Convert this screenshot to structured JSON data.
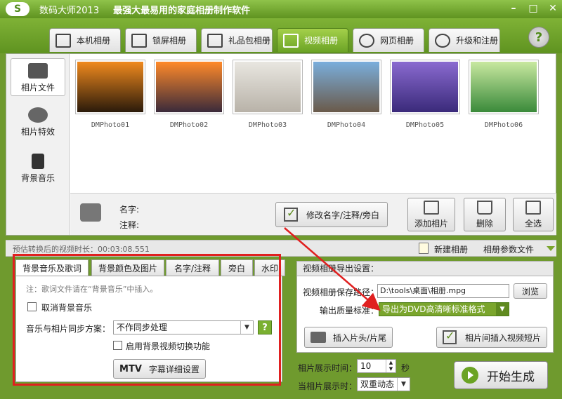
{
  "window": {
    "logo": "S",
    "title": "数码大师2013",
    "slogan": "最强大最易用的家庭相册制作软件",
    "minimize": "–",
    "maximize": "□",
    "close": "✕"
  },
  "tabs": [
    {
      "label": "本机相册"
    },
    {
      "label": "锁屏相册"
    },
    {
      "label": "礼品包相册"
    },
    {
      "label": "视频相册"
    },
    {
      "label": "网页相册"
    },
    {
      "label": "升级和注册"
    }
  ],
  "help": "?",
  "sidebar": {
    "items": [
      {
        "label": "相片文件"
      },
      {
        "label": "相片特效"
      },
      {
        "label": "背景音乐"
      }
    ]
  },
  "photos": [
    {
      "name": "DMPhoto01",
      "color_top": "#f08a1e",
      "color_bottom": "#2a1a0a"
    },
    {
      "name": "DMPhoto02",
      "color_top": "#ff8a2a",
      "color_bottom": "#3a2a3a"
    },
    {
      "name": "DMPhoto03",
      "color_top": "#e8e6e0",
      "color_bottom": "#b8b2a8"
    },
    {
      "name": "DMPhoto04",
      "color_top": "#7aaedc",
      "color_bottom": "#6a5a4a"
    },
    {
      "name": "DMPhoto05",
      "color_top": "#8a6ad0",
      "color_bottom": "#3a2a7a"
    },
    {
      "name": "DMPhoto06",
      "color_top": "#c8e8a0",
      "color_bottom": "#3a8a3a"
    }
  ],
  "info": {
    "name_label": "名字:",
    "note_label": "注释:",
    "edit_button": "修改名字/注释/旁白",
    "add_photo": "添加相片",
    "delete": "删除",
    "select_all": "全选"
  },
  "duration_bar": {
    "text": "预估转换后的视频时长：00:03:08.551",
    "new_album": "新建相册",
    "album_params": "相册参数文件"
  },
  "bottom_tabs": [
    {
      "label": "背景音乐及歌词"
    },
    {
      "label": "背景颜色及图片"
    },
    {
      "label": "名字/注释"
    },
    {
      "label": "旁白"
    },
    {
      "label": "水印"
    }
  ],
  "music_panel": {
    "note": "注：歌词文件请在“背景音乐”中插入。",
    "cancel_music": "取消背景音乐",
    "sync_label": "音乐与相片同步方案：",
    "sync_value": "不作同步处理",
    "bg_video_switch": "启用背景视频切换功能",
    "mtv_badge": "MTV",
    "subtitle_settings": "字幕详细设置"
  },
  "export": {
    "header": "视频相册导出设置：",
    "path_label": "视频相册保存路径：",
    "path_value": "D:\\tools\\桌面\\相册.mpg",
    "browse": "浏览",
    "quality_label": "输出质量标准：",
    "quality_value": "导出为DVD高清晰标准格式",
    "insert_head_tail": "插入片头/片尾",
    "insert_clip": "相片间插入视频短片"
  },
  "bottom_controls": {
    "show_time_label": "相片展示时间：",
    "show_time_value": "10",
    "show_time_unit": "秒",
    "show_mode_label": "当相片展示时：",
    "show_mode_value": "双重动态",
    "start": "开始生成"
  },
  "colors": {
    "accent_green": "#6ca426",
    "highlight_red": "#e02020"
  }
}
